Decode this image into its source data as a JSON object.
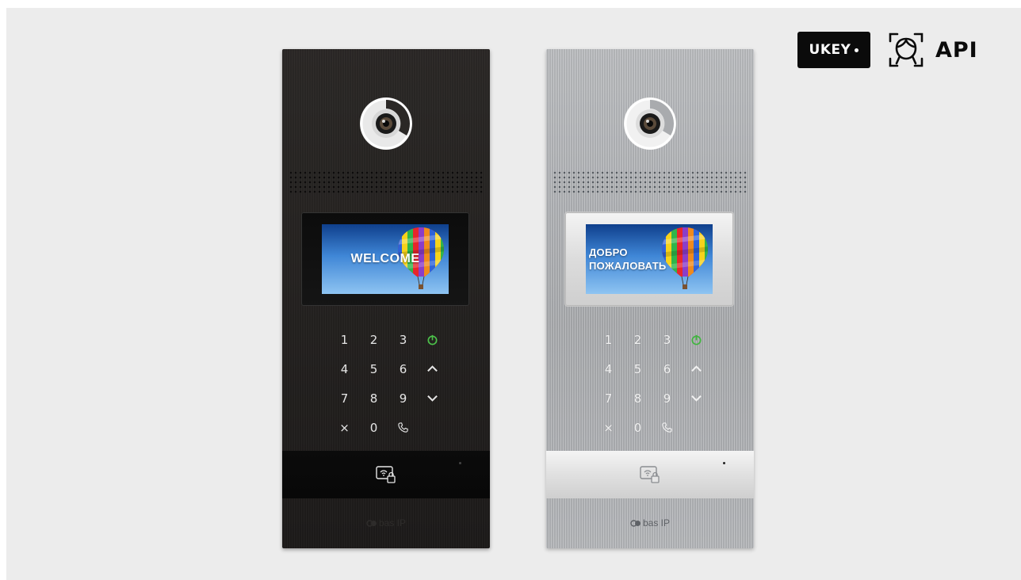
{
  "badges": {
    "ukey_label": "UKEY",
    "face_icon": "face-recognition-icon",
    "api_label": "API"
  },
  "panels": [
    {
      "finish": "black",
      "screen_text": [
        "WELCOME"
      ],
      "keys": [
        "1",
        "2",
        "3",
        "power-icon",
        "4",
        "5",
        "6",
        "up-arrow-icon",
        "7",
        "8",
        "9",
        "down-arrow-icon",
        "×",
        "0",
        "phone-icon"
      ],
      "logo": "bas IP"
    },
    {
      "finish": "silver",
      "screen_text": [
        "ДОБРО",
        "ПОЖАЛОВАТЬ"
      ],
      "keys": [
        "1",
        "2",
        "3",
        "power-icon",
        "4",
        "5",
        "6",
        "up-arrow-icon",
        "7",
        "8",
        "9",
        "down-arrow-icon",
        "×",
        "0",
        "phone-icon"
      ],
      "logo": "bas IP"
    }
  ],
  "colors": {
    "background": "#ececec",
    "power_key": "#4cc24a",
    "panel_black": "#24211f",
    "panel_silver": "#b0b2b5"
  }
}
